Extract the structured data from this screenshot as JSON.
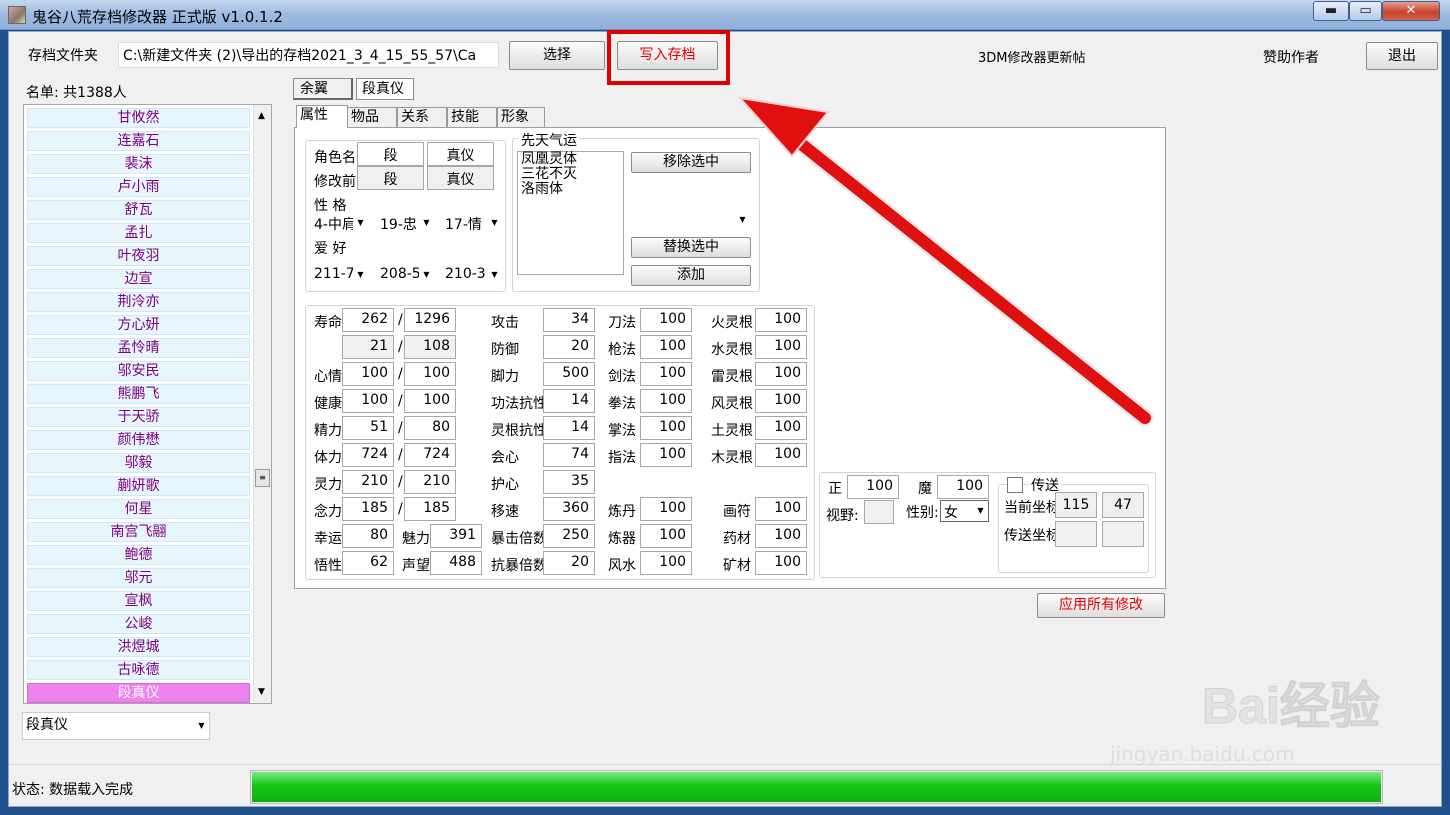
{
  "window": {
    "title": "鬼谷八荒存档修改器 正式版 v1.0.1.2",
    "min_glyph": "▬",
    "max_glyph": "▭",
    "close_glyph": "✕"
  },
  "toolbar": {
    "folder_label": "存档文件夹",
    "folder_path": "C:\\新建文件夹 (2)\\导出的存档2021_3_4_15_55_57\\Ca",
    "select_label": "选择",
    "write_label": "写入存档",
    "update_link": "3DM修改器更新帖",
    "sponsor_label": "赞助作者",
    "exit_label": "退出"
  },
  "roster": {
    "count_label": "名单: 共1388人",
    "items": [
      "甘攸然",
      "连嘉石",
      "裴沫",
      "卢小雨",
      "舒瓦",
      "孟扎",
      "叶夜羽",
      "边宣",
      "荆泠亦",
      "方心妍",
      "孟怜晴",
      "邬安民",
      "熊鹏飞",
      "于天骄",
      "颜伟懋",
      "邬毅",
      "蒯妍歌",
      "何星",
      "南宫飞翮",
      "鲍德",
      "邬元",
      "宣枫",
      "公峻",
      "洪煜城",
      "古咏德",
      "段真仪"
    ],
    "selected": "段真仪",
    "search_value": "段真仪"
  },
  "char_tabs": [
    "余翼",
    "段真仪"
  ],
  "sub_tabs": [
    "属性",
    "物品",
    "关系",
    "技能",
    "形象"
  ],
  "basic": {
    "name_label": "角色名",
    "prev_label": "修改前",
    "surname": "段",
    "given": "真仪",
    "prev_surname": "段",
    "prev_given": "真仪",
    "personality_label": "性  格",
    "personality": [
      "4-中肩",
      "19-忠",
      "17-情"
    ],
    "hobby_label": "爱  好",
    "hobbies": [
      "211-7",
      "208-5",
      "210-3"
    ]
  },
  "fortune": {
    "title": "先天气运",
    "items": [
      "凤凰灵体",
      "三花不灭",
      "洛雨体"
    ],
    "remove_btn": "移除选中",
    "replace_btn": "替换选中",
    "add_btn": "添加"
  },
  "stats": {
    "col1": [
      {
        "label": "寿命",
        "v1": "262",
        "v2": "1296"
      },
      {
        "label": "",
        "v1": "21",
        "v2": "108"
      },
      {
        "label": "心情",
        "v1": "100",
        "v2": "100"
      },
      {
        "label": "健康",
        "v1": "100",
        "v2": "100"
      },
      {
        "label": "精力",
        "v1": "51",
        "v2": "80"
      },
      {
        "label": "体力",
        "v1": "724",
        "v2": "724"
      },
      {
        "label": "灵力",
        "v1": "210",
        "v2": "210"
      },
      {
        "label": "念力",
        "v1": "185",
        "v2": "185"
      }
    ],
    "col2": [
      {
        "label": "攻击",
        "v": "34"
      },
      {
        "label": "防御",
        "v": "20"
      },
      {
        "label": "脚力",
        "v": "500"
      },
      {
        "label": "功法抗性",
        "v": "14"
      },
      {
        "label": "灵根抗性",
        "v": "14"
      },
      {
        "label": "会心",
        "v": "74"
      },
      {
        "label": "护心",
        "v": "35"
      },
      {
        "label": "移速",
        "v": "360"
      },
      {
        "label": "暴击倍数",
        "v": "250"
      },
      {
        "label": "抗暴倍数",
        "v": "20"
      }
    ],
    "col3": [
      {
        "label": "刀法",
        "v": "100"
      },
      {
        "label": "枪法",
        "v": "100"
      },
      {
        "label": "剑法",
        "v": "100"
      },
      {
        "label": "拳法",
        "v": "100"
      },
      {
        "label": "掌法",
        "v": "100"
      },
      {
        "label": "指法",
        "v": "100"
      },
      {
        "label": "炼丹",
        "v": "100"
      },
      {
        "label": "炼器",
        "v": "100"
      },
      {
        "label": "风水",
        "v": "100"
      }
    ],
    "col4": [
      {
        "label": "火灵根",
        "v": "100"
      },
      {
        "label": "水灵根",
        "v": "100"
      },
      {
        "label": "雷灵根",
        "v": "100"
      },
      {
        "label": "风灵根",
        "v": "100"
      },
      {
        "label": "土灵根",
        "v": "100"
      },
      {
        "label": "木灵根",
        "v": "100"
      },
      {
        "label": "画符",
        "v": "100"
      },
      {
        "label": "药材",
        "v": "100"
      },
      {
        "label": "矿材",
        "v": "100"
      }
    ],
    "luck": {
      "label": "幸运",
      "v": "80"
    },
    "charm": {
      "label": "魅力",
      "v": "391"
    },
    "insight": {
      "label": "悟性",
      "v": "62"
    },
    "fame": {
      "label": "声望",
      "v": "488"
    }
  },
  "misc": {
    "righteous_label": "正",
    "righteous": "100",
    "demon_label": "魔",
    "demon": "100",
    "vision_label": "视野:",
    "vision": "",
    "gender_label": "性别:",
    "gender": "女",
    "teleport_label": "传送",
    "cur_coord_label": "当前坐标",
    "cur_x": "115",
    "cur_y": "47",
    "tp_coord_label": "传送坐标",
    "tp_x": "",
    "tp_y": ""
  },
  "apply_label": "应用所有修改",
  "status": {
    "text": "状态: 数据载入完成",
    "progress": 1.0
  },
  "watermark": {
    "brand": "Bai经验",
    "url": "jingyan.baidu.com"
  },
  "colors": {
    "accent_red": "#ff0000",
    "list_text": "#800080",
    "list_selected": "#ee82ee",
    "progress": "#14c814"
  }
}
